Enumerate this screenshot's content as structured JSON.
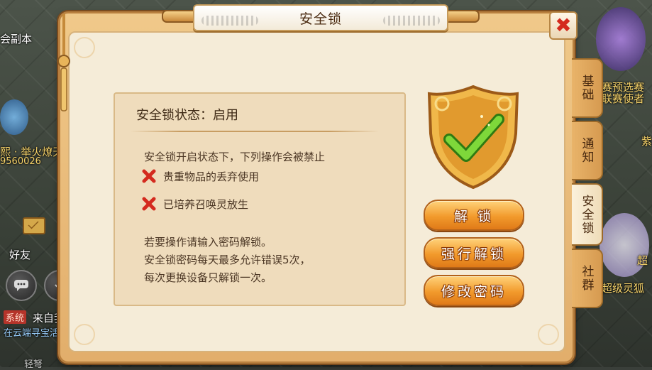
{
  "dialog": {
    "title": "安全锁",
    "close_symbol": "✖"
  },
  "tabs": [
    {
      "label": "基础",
      "active": false
    },
    {
      "label": "通知",
      "active": false
    },
    {
      "label": "安全锁",
      "active": true
    },
    {
      "label": "社群",
      "active": false
    }
  ],
  "status": {
    "label": "安全锁状态：启用"
  },
  "restrictions": {
    "intro": "安全锁开启状态下，下列操作会被禁止",
    "items": [
      "贵重物品的丢弃使用",
      "已培养召唤灵放生"
    ]
  },
  "notes": [
    "若要操作请输入密码解锁。",
    "安全锁密码每天最多允许错误5次，",
    "每次更换设备只解锁一次。"
  ],
  "buttons": {
    "unlock": "解 锁",
    "force_unlock": "强行解锁",
    "change_password": "修改密码"
  },
  "shield_icon": "shield-check-icon",
  "background": {
    "left_texts": [
      "会副本",
      "熙 · 举火燎天",
      "9560026",
      "好友",
      "来自我",
      "在云端寻宝活"
    ],
    "system_badge": "系统",
    "right_texts": [
      "赛预选赛",
      "联赛使者",
      "紫",
      "超级灵狐",
      "超"
    ],
    "bottom_text": "轻弩"
  },
  "colors": {
    "button_orange": "#f29a2c",
    "check_green": "#6fcf2a",
    "x_red": "#d42a1e",
    "shield_gold": "#e9a43a"
  }
}
